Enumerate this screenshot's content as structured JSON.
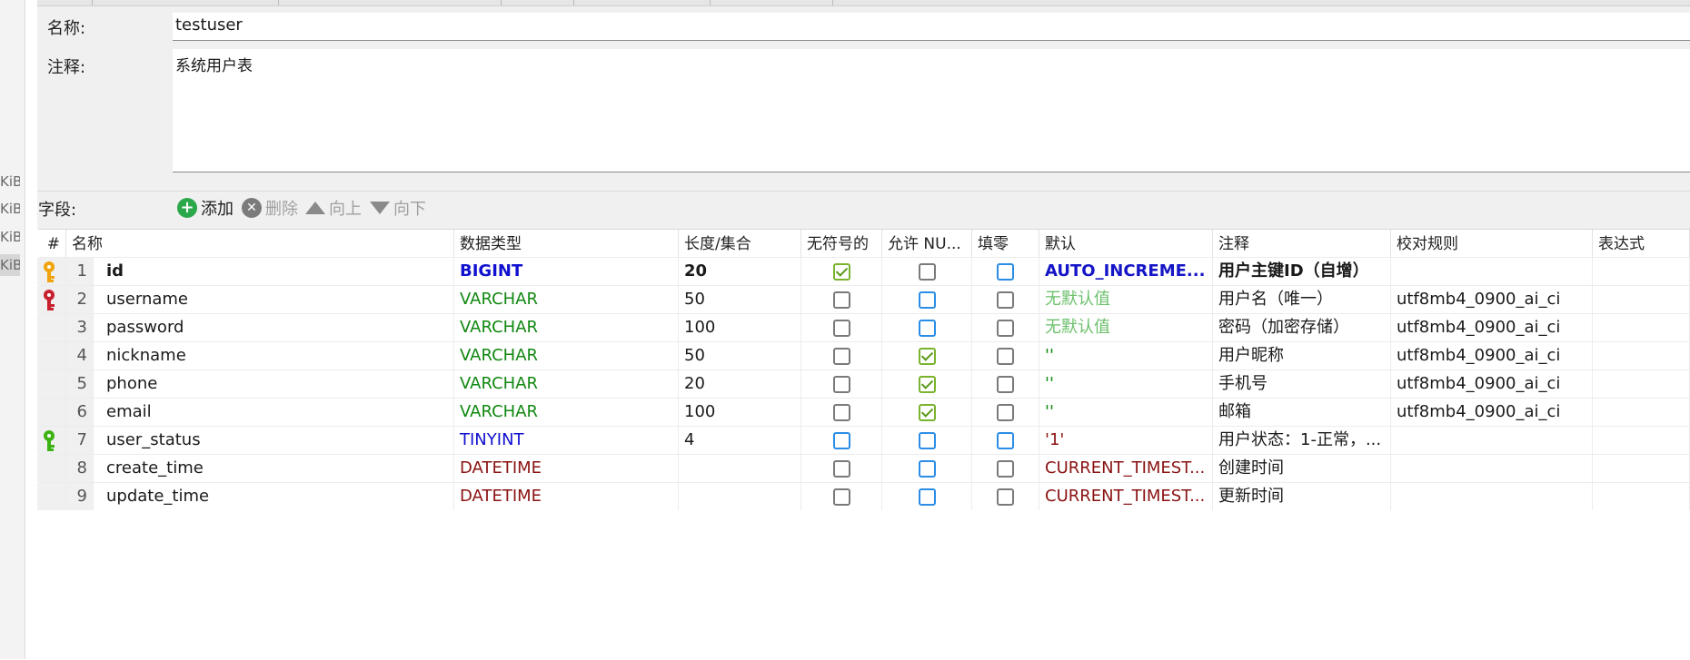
{
  "side_labels": [
    "KiB",
    "KiB",
    "KiB",
    "KiB"
  ],
  "form": {
    "name_label": "名称:",
    "name_value": "testuser",
    "comment_label": "注释:",
    "comment_value": "系统用户表"
  },
  "toolbar": {
    "fields_label": "字段:",
    "add": "添加",
    "delete": "删除",
    "up": "向上",
    "down": "向下"
  },
  "columns": [
    "#",
    "名称",
    "数据类型",
    "长度/集合",
    "无符号的",
    "允许 NU...",
    "填零",
    "默认",
    "注释",
    "校对规则",
    "表达式"
  ],
  "rows": [
    {
      "num": "1",
      "name": "id",
      "type": "BIGINT",
      "len": "20",
      "unsigned": "checked",
      "nullable": "unchecked",
      "zerofill": "blue",
      "default": "AUTO_INCREME...",
      "comment": "用户主键ID（自增）",
      "collation": "",
      "key": "primary",
      "bold": true
    },
    {
      "num": "2",
      "name": "username",
      "type": "VARCHAR",
      "len": "50",
      "unsigned": "unchecked",
      "nullable": "blue",
      "zerofill": "unchecked",
      "default": "无默认值",
      "comment": "用户名（唯一）",
      "collation": "utf8mb4_0900_ai_ci",
      "key": "unique",
      "bold": false
    },
    {
      "num": "3",
      "name": "password",
      "type": "VARCHAR",
      "len": "100",
      "unsigned": "unchecked",
      "nullable": "blue",
      "zerofill": "unchecked",
      "default": "无默认值",
      "comment": "密码（加密存储）",
      "collation": "utf8mb4_0900_ai_ci",
      "key": "",
      "bold": false
    },
    {
      "num": "4",
      "name": "nickname",
      "type": "VARCHAR",
      "len": "50",
      "unsigned": "unchecked",
      "nullable": "checked",
      "zerofill": "unchecked",
      "default": "''",
      "comment": "用户昵称",
      "collation": "utf8mb4_0900_ai_ci",
      "key": "",
      "bold": false
    },
    {
      "num": "5",
      "name": "phone",
      "type": "VARCHAR",
      "len": "20",
      "unsigned": "unchecked",
      "nullable": "checked",
      "zerofill": "unchecked",
      "default": "''",
      "comment": "手机号",
      "collation": "utf8mb4_0900_ai_ci",
      "key": "",
      "bold": false
    },
    {
      "num": "6",
      "name": "email",
      "type": "VARCHAR",
      "len": "100",
      "unsigned": "unchecked",
      "nullable": "checked",
      "zerofill": "unchecked",
      "default": "''",
      "comment": "邮箱",
      "collation": "utf8mb4_0900_ai_ci",
      "key": "",
      "bold": false
    },
    {
      "num": "7",
      "name": "user_status",
      "type": "TINYINT",
      "len": "4",
      "unsigned": "blue",
      "nullable": "blue",
      "zerofill": "blue",
      "default": "'1'",
      "comment": "用户状态：1-正常，...",
      "collation": "",
      "key": "index",
      "bold": false
    },
    {
      "num": "8",
      "name": "create_time",
      "type": "DATETIME",
      "len": "",
      "unsigned": "unchecked",
      "nullable": "blue",
      "zerofill": "unchecked",
      "default": "CURRENT_TIMEST...",
      "comment": "创建时间",
      "collation": "",
      "key": "",
      "bold": false
    },
    {
      "num": "9",
      "name": "update_time",
      "type": "DATETIME",
      "len": "",
      "unsigned": "unchecked",
      "nullable": "blue",
      "zerofill": "unchecked",
      "default": "CURRENT_TIMEST...",
      "comment": "更新时间",
      "collation": "",
      "key": "",
      "bold": false
    }
  ],
  "colors": {
    "bigint": "#1010d0",
    "varchar": "#118811",
    "tinyint": "#1010d0",
    "datetime": "#8b1212",
    "key_primary": "#f0a30a",
    "key_unique": "#c8202e",
    "key_index": "#3cb312"
  }
}
